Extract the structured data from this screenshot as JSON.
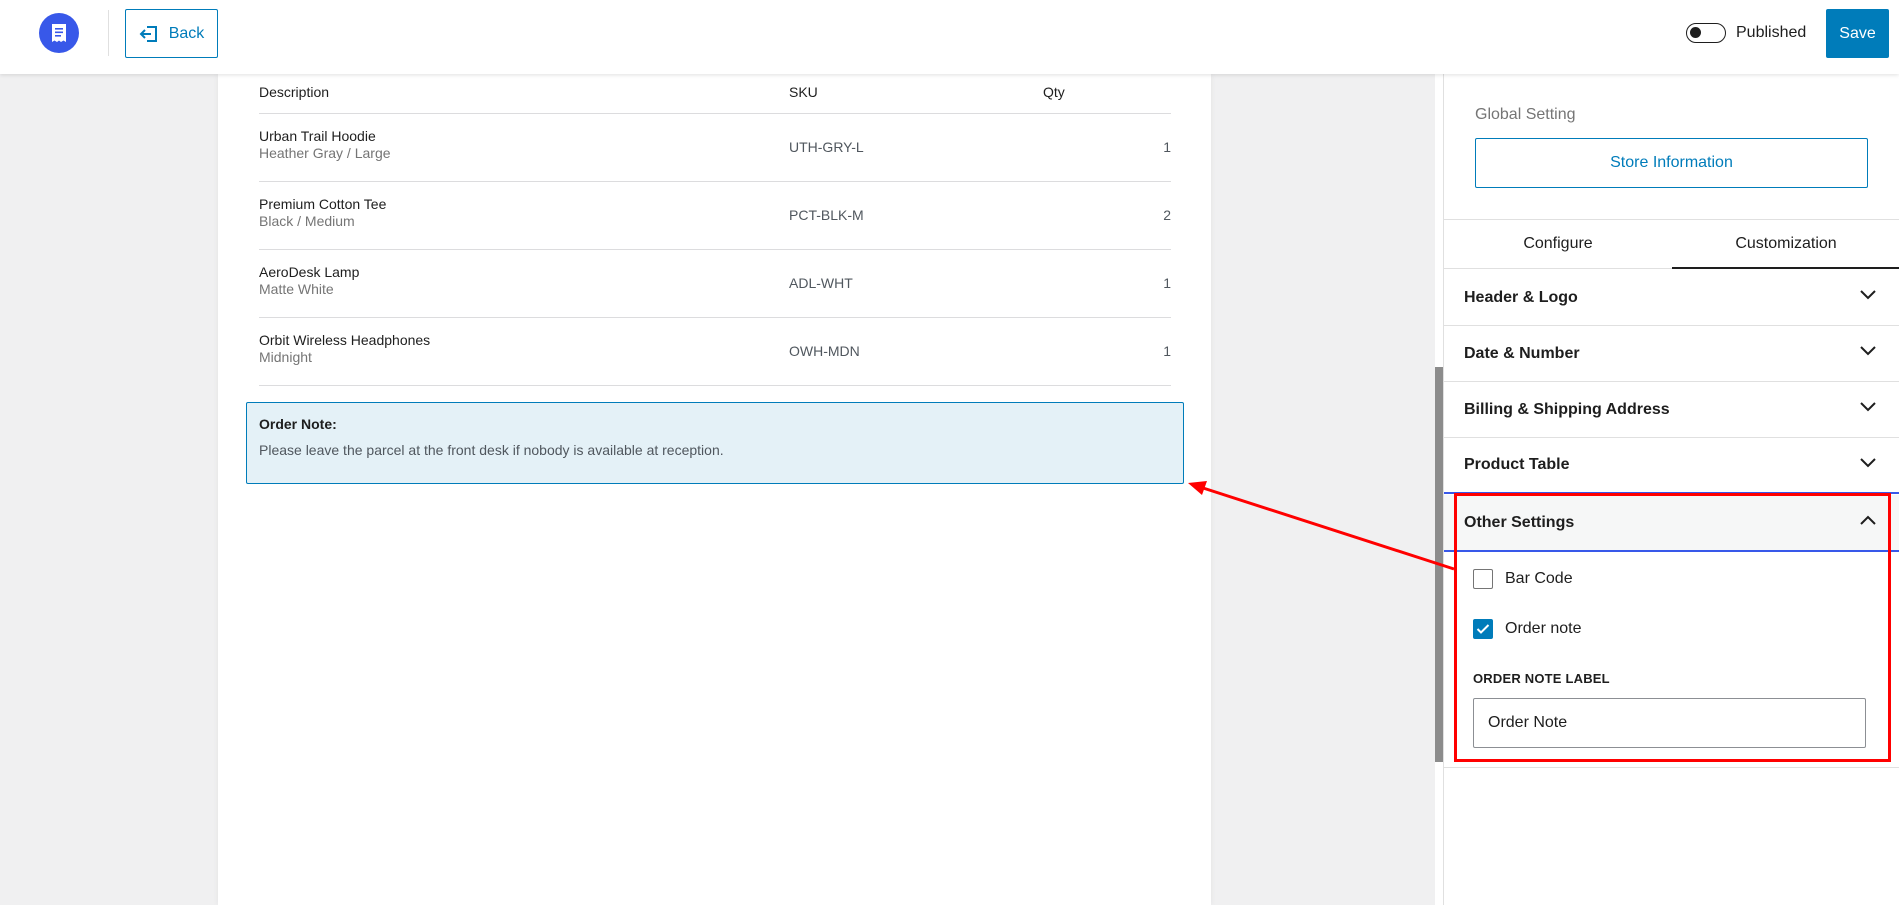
{
  "topbar": {
    "logo_icon": "receipt-icon",
    "back_label": "Back",
    "published_label": "Published",
    "save_label": "Save"
  },
  "table": {
    "headers": {
      "description": "Description",
      "sku": "SKU",
      "qty": "Qty"
    },
    "rows": [
      {
        "name": "Urban Trail Hoodie",
        "variant": "Heather Gray / Large",
        "sku": "UTH-GRY-L",
        "qty": "1"
      },
      {
        "name": "Premium Cotton Tee",
        "variant": "Black / Medium",
        "sku": "PCT-BLK-M",
        "qty": "2"
      },
      {
        "name": "AeroDesk Lamp",
        "variant": "Matte White",
        "sku": "ADL-WHT",
        "qty": "1"
      },
      {
        "name": "Orbit Wireless Headphones",
        "variant": "Midnight",
        "sku": "OWH-MDN",
        "qty": "1"
      }
    ]
  },
  "order_note": {
    "title": "Order Note:",
    "text": "Please leave the parcel at the front desk if nobody is available at reception."
  },
  "sidebar": {
    "global_label": "Global Setting",
    "store_info_label": "Store Information",
    "tabs": [
      {
        "label": "Configure",
        "active": false
      },
      {
        "label": "Customization",
        "active": true
      }
    ],
    "panels": [
      {
        "label": "Header & Logo",
        "expanded": false
      },
      {
        "label": "Date & Number",
        "expanded": false
      },
      {
        "label": "Billing & Shipping Address",
        "expanded": false
      },
      {
        "label": "Product Table",
        "expanded": false
      },
      {
        "label": "Other Settings",
        "expanded": true
      }
    ],
    "other_settings": {
      "barcode_label": "Bar Code",
      "barcode_checked": false,
      "order_note_label": "Order note",
      "order_note_checked": true,
      "field_label": "ORDER NOTE LABEL",
      "field_value": "Order Note"
    }
  },
  "colors": {
    "accent": "#007cba",
    "logo": "#3858e9",
    "annotation": "#ff0000",
    "note_bg": "#e4f1f7"
  }
}
